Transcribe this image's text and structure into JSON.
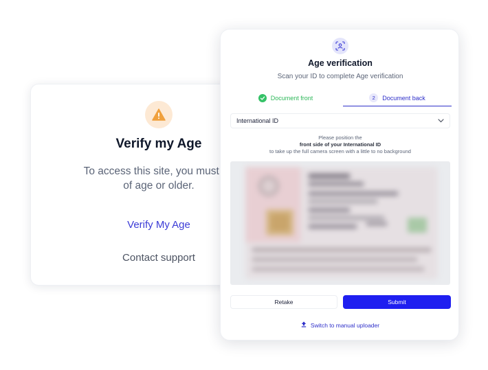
{
  "verify_card": {
    "icon": "warning-icon",
    "title": "Verify my Age",
    "description_line1": "To access this site, you must be",
    "description_line2": "of age or older.",
    "verify_link": "Verify My Age",
    "support_link": "Contact support"
  },
  "modal": {
    "icon": "face-scan-icon",
    "title": "Age verification",
    "subtitle": "Scan your ID to complete Age verification",
    "tabs": {
      "front": {
        "label": "Document front",
        "state": "completed",
        "icon": "check-circle-icon"
      },
      "back": {
        "label": "Document back",
        "step": "2",
        "state": "active"
      }
    },
    "document_select": {
      "value": "International ID",
      "icon": "chevron-down-icon"
    },
    "instructions": {
      "line1": "Please position the",
      "line2": "front side of your International ID",
      "line3": "to take up the full camera screen with a little to no background"
    },
    "buttons": {
      "retake": "Retake",
      "submit": "Submit"
    },
    "manual_link": {
      "label": "Switch to manual uploader",
      "icon": "upload-icon"
    }
  },
  "colors": {
    "accent": "#1f1ff0",
    "link": "#2d2ec9",
    "success": "#35c267",
    "warning": "#f0a03c"
  }
}
